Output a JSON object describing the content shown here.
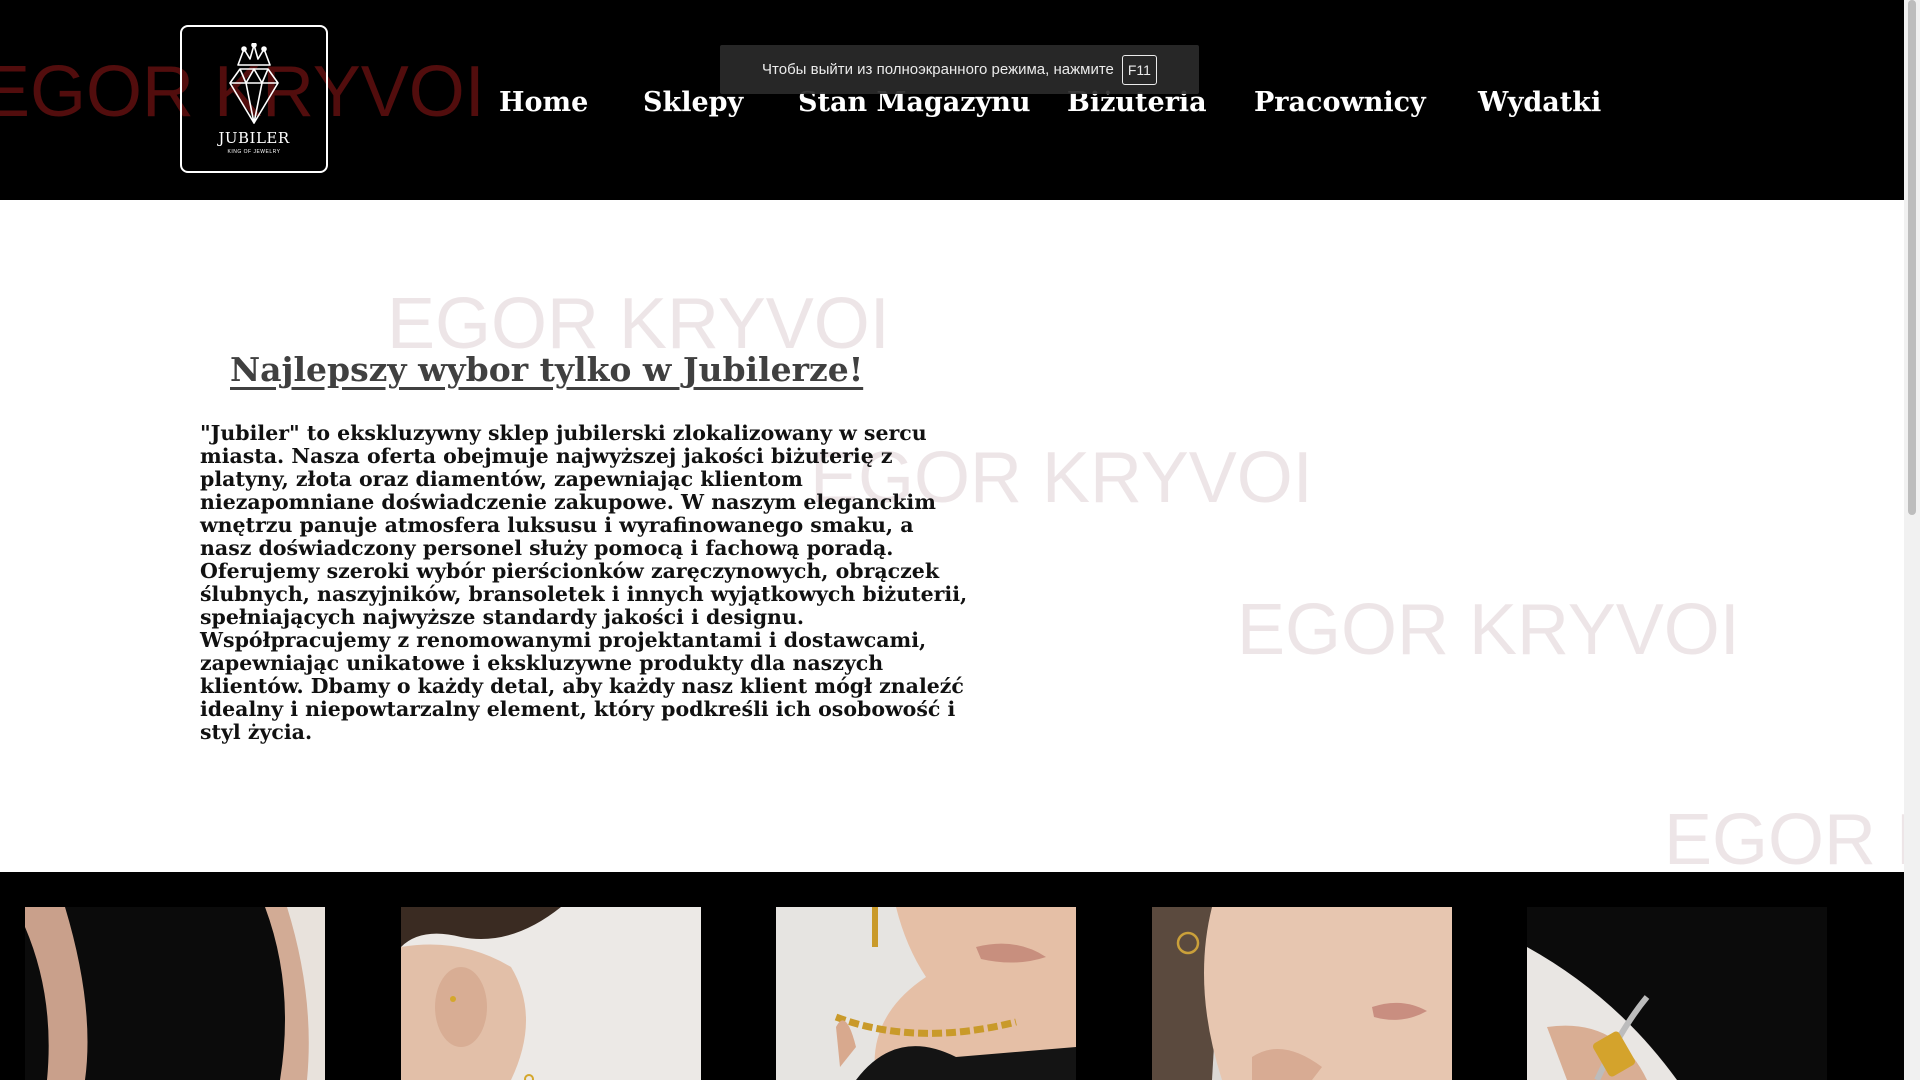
{
  "brand": {
    "name": "JUBILER",
    "tagline": "KING OF JEWELRY",
    "watermark": "EGOR KRYVOI"
  },
  "nav": {
    "items": [
      {
        "label": "Home"
      },
      {
        "label": "Sklepy"
      },
      {
        "label": "Stan Magazynu"
      },
      {
        "label": "Biżuteria"
      },
      {
        "label": "Pracownicy"
      },
      {
        "label": "Wydatki"
      }
    ]
  },
  "fullscreen_notice": {
    "text": "Чтобы выйти из полноэкранного режима, нажмите",
    "key": "F11"
  },
  "hero": {
    "headline": "Najlepszy wybor tylko w Jubilerze!",
    "description": "\"Jubiler\" to ekskluzywny sklep jubilerski zlokalizowany w sercu miasta. Nasza oferta obejmuje najwyższej jakości biżuterię z platyny, złota oraz diamentów, zapewniając klientom niezapomniane doświadczenie zakupowe. W naszym eleganckim wnętrzu panuje atmosfera luksusu i wyrafinowanego smaku, a nasz doświadczony personel służy pomocą i fachową poradą. Oferujemy szeroki wybór pierścionków zaręczynowych, obrączek ślubnych, naszyjników, bransoletek i innych wyjątkowych biżuterii, spełniających najwyższe standardy jakości i designu. Współpracujemy z renomowanymi projektantami i dostawcami, zapewniając unikatowe i ekskluzywne produkty dla naszych klientów. Dbamy o każdy detal, aby każdy nasz klient mógł znaleźć idealny i niepowtarzalny element, który podkreśli ich osobowość i styl życia."
  },
  "gallery": {
    "items": [
      {
        "subject": "wrist-bracelet-photo"
      },
      {
        "subject": "ear-earring-photo"
      },
      {
        "subject": "neck-chain-photo"
      },
      {
        "subject": "hoop-earring-photo"
      },
      {
        "subject": "gold-bracelet-photo"
      }
    ]
  },
  "colors": {
    "header_bg": "#000000",
    "page_bg": "#ffffff",
    "headline": "#404040",
    "watermark": "#bea0aa",
    "watermark_dark": "#6e1212"
  }
}
